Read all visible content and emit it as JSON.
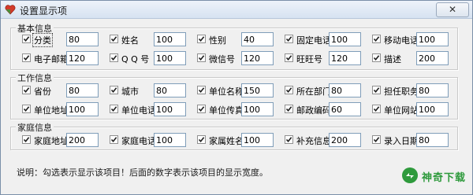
{
  "window": {
    "title": "设置显示项",
    "close_symbol": "✕"
  },
  "groups": [
    {
      "label": "基本信息",
      "rows": [
        [
          {
            "label": "分类",
            "checked": true,
            "value": "80"
          },
          {
            "label": "姓名",
            "checked": true,
            "value": "100"
          },
          {
            "label": "性别",
            "checked": true,
            "value": "40"
          },
          {
            "label": "固定电话",
            "checked": true,
            "value": "100"
          },
          {
            "label": "移动电话",
            "checked": true,
            "value": "100"
          }
        ],
        [
          {
            "label": "电子邮箱",
            "checked": true,
            "value": "120"
          },
          {
            "label": "Q Q 号",
            "checked": true,
            "value": "100"
          },
          {
            "label": "微信号",
            "checked": true,
            "value": "120"
          },
          {
            "label": "旺旺号",
            "checked": true,
            "value": "120"
          },
          {
            "label": "描述",
            "checked": true,
            "value": "200"
          }
        ]
      ]
    },
    {
      "label": "工作信息",
      "rows": [
        [
          {
            "label": "省份",
            "checked": true,
            "value": "80"
          },
          {
            "label": "城市",
            "checked": true,
            "value": "80"
          },
          {
            "label": "单位名称",
            "checked": true,
            "value": "150"
          },
          {
            "label": "所在部门",
            "checked": true,
            "value": "80"
          },
          {
            "label": "担任职务",
            "checked": true,
            "value": "80"
          }
        ],
        [
          {
            "label": "单位地址",
            "checked": true,
            "value": "100"
          },
          {
            "label": "单位电话",
            "checked": true,
            "value": "100"
          },
          {
            "label": "单位传真",
            "checked": true,
            "value": "100"
          },
          {
            "label": "邮政编码",
            "checked": true,
            "value": "60"
          },
          {
            "label": "单位网站",
            "checked": true,
            "value": "100"
          }
        ]
      ]
    },
    {
      "label": "家庭信息",
      "rows": [
        [
          {
            "label": "家庭地址",
            "checked": true,
            "value": "200"
          },
          {
            "label": "家庭电话",
            "checked": true,
            "value": "100"
          },
          {
            "label": "家属姓名",
            "checked": true,
            "value": "100"
          },
          {
            "label": "补充信息",
            "checked": true,
            "value": "200"
          },
          {
            "label": "录入日期",
            "checked": true,
            "value": "80"
          }
        ]
      ]
    }
  ],
  "note": "说明：勾选表示显示该项目！后面的数字表示该项目的显示宽度。",
  "watermark": {
    "text": "神奇下载"
  },
  "colors": {
    "input_border": "#7f9db9",
    "watermark_green": "#2e9a3c",
    "dialog_bg": "#f0f0f0"
  }
}
